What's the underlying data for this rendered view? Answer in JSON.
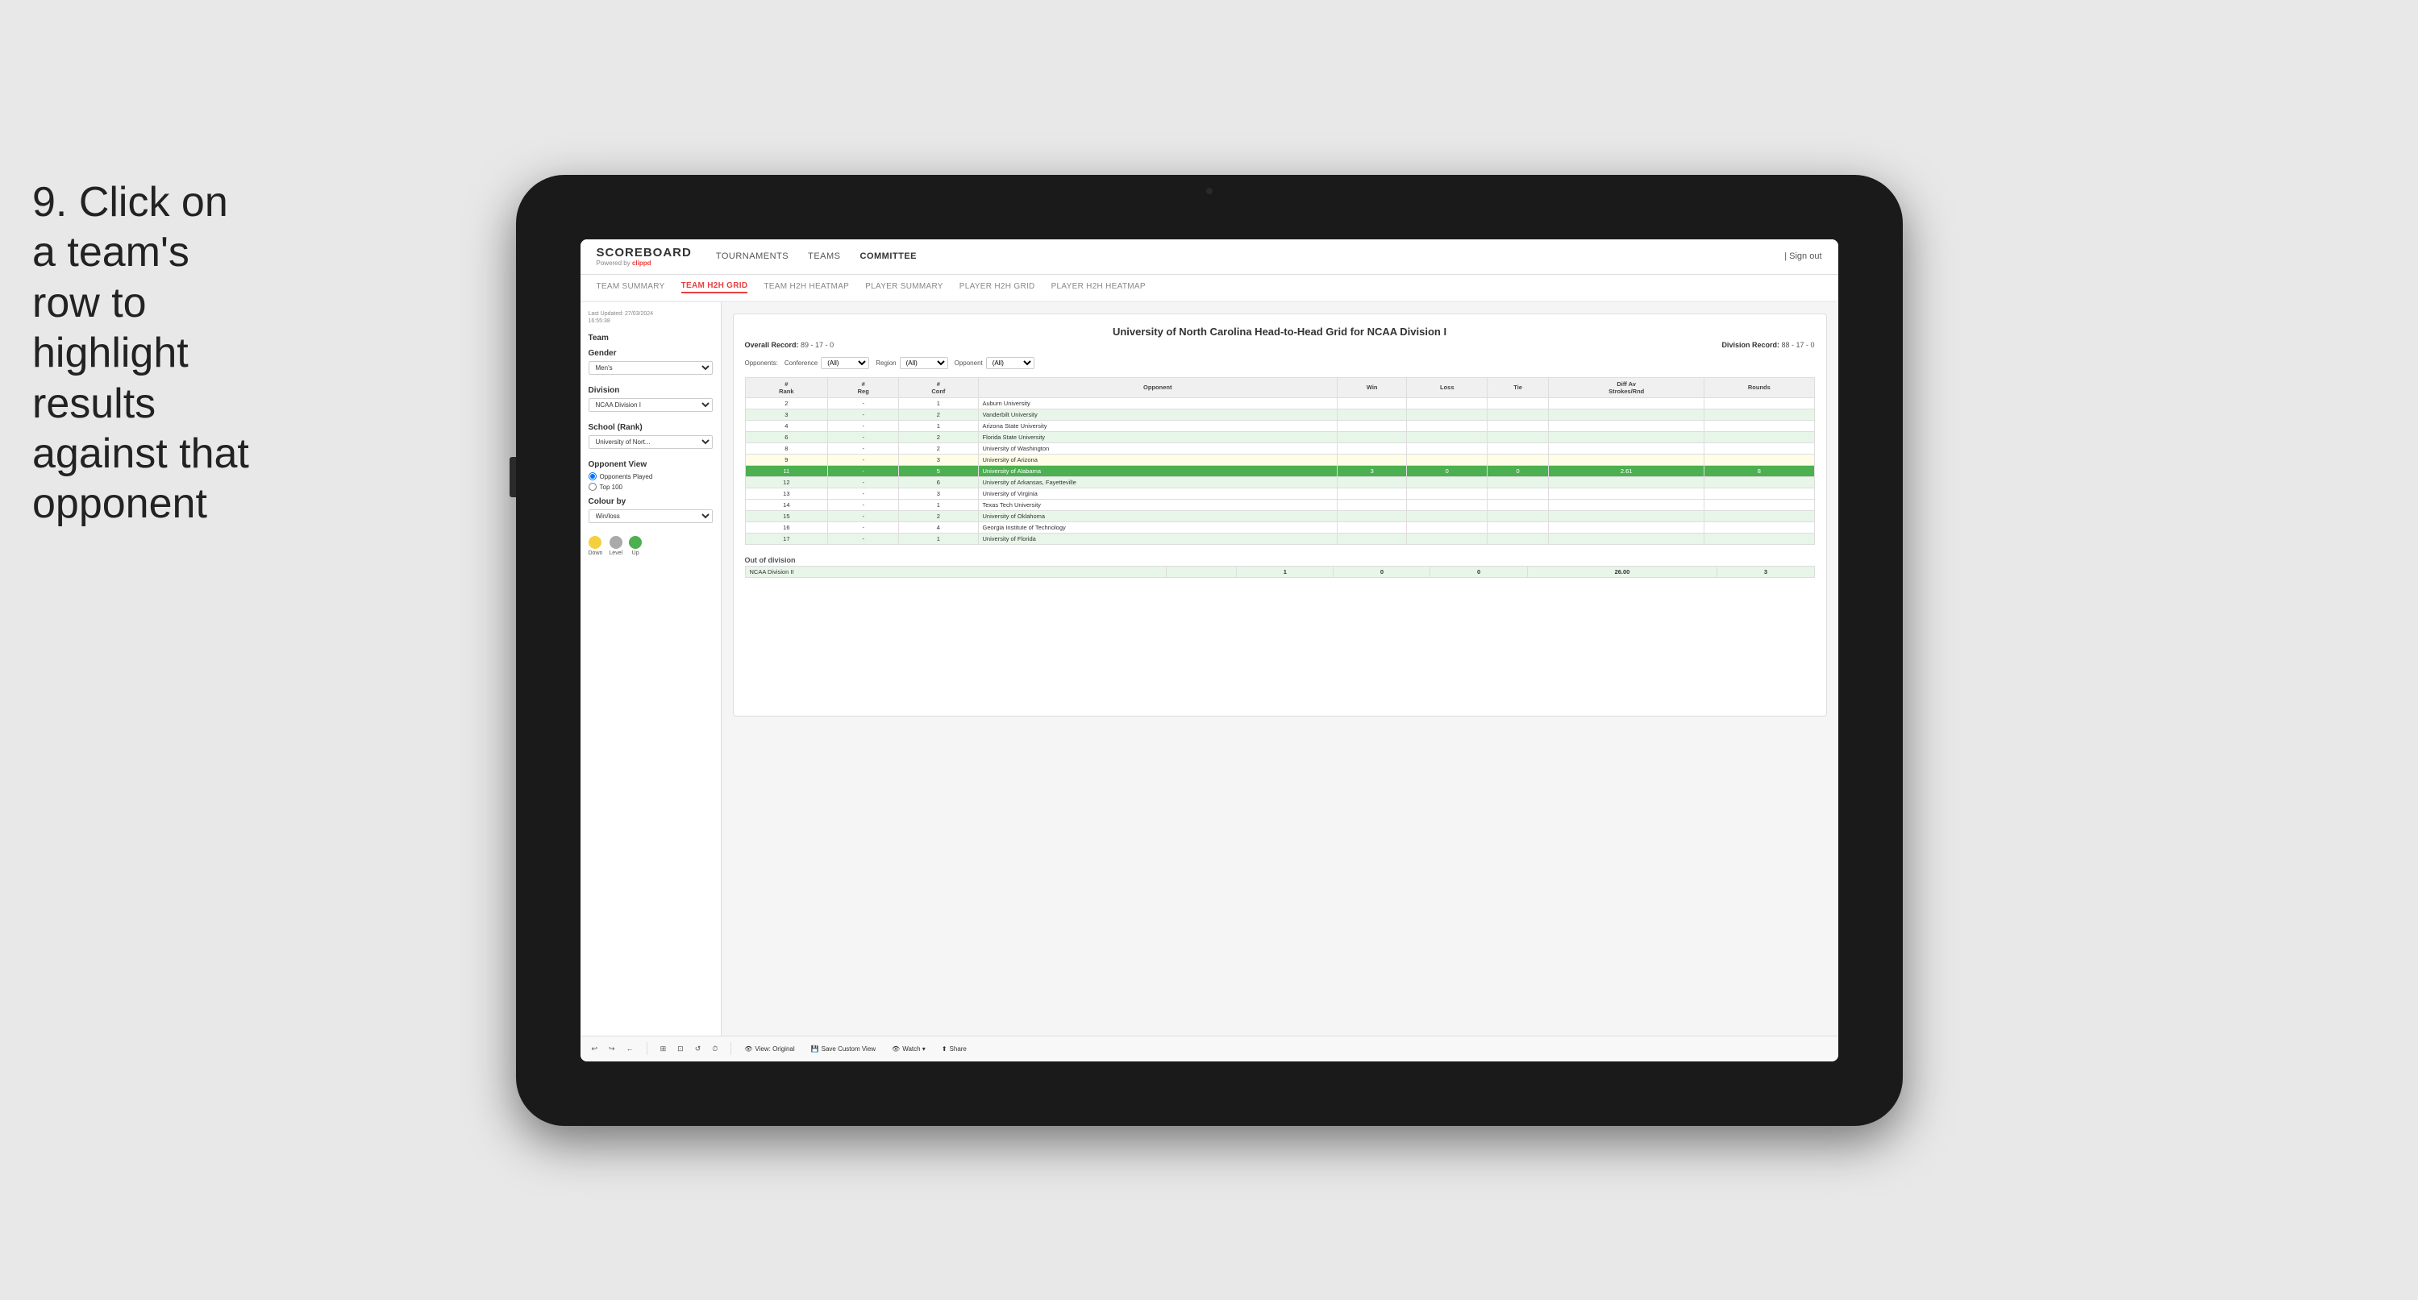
{
  "instruction": {
    "step_number": "9.",
    "text": "Click on a team's row to highlight results against that opponent"
  },
  "app": {
    "logo": {
      "scoreboard": "SCOREBOARD",
      "powered_by": "Powered by",
      "clippd": "clippd"
    },
    "nav": {
      "items": [
        {
          "label": "TOURNAMENTS",
          "active": false
        },
        {
          "label": "TEAMS",
          "active": false
        },
        {
          "label": "COMMITTEE",
          "active": true
        }
      ],
      "sign_out": "| Sign out"
    },
    "sub_nav": {
      "items": [
        {
          "label": "TEAM SUMMARY",
          "active": false
        },
        {
          "label": "TEAM H2H GRID",
          "active": true
        },
        {
          "label": "TEAM H2H HEATMAP",
          "active": false
        },
        {
          "label": "PLAYER SUMMARY",
          "active": false
        },
        {
          "label": "PLAYER H2H GRID",
          "active": false
        },
        {
          "label": "PLAYER H2H HEATMAP",
          "active": false
        }
      ]
    }
  },
  "left_panel": {
    "last_updated_label": "Last Updated: 27/03/2024",
    "last_updated_time": "16:55:38",
    "team_label": "Team",
    "gender_label": "Gender",
    "gender_value": "Men's",
    "division_label": "Division",
    "division_value": "NCAA Division I",
    "school_rank_label": "School (Rank)",
    "school_rank_value": "University of Nort...",
    "opponent_view_label": "Opponent View",
    "opponents_played_label": "Opponents Played",
    "top_100_label": "Top 100",
    "colour_by_label": "Colour by",
    "colour_by_value": "Win/loss",
    "legend": {
      "down_label": "Down",
      "level_label": "Level",
      "up_label": "Up"
    }
  },
  "report": {
    "title": "University of North Carolina Head-to-Head Grid for NCAA Division I",
    "overall_record_label": "Overall Record:",
    "overall_record_value": "89 - 17 - 0",
    "division_record_label": "Division Record:",
    "division_record_value": "88 - 17 - 0",
    "filters": {
      "opponents_label": "Opponents:",
      "conference_label": "Conference",
      "conference_value": "(All)",
      "region_label": "Region",
      "region_value": "(All)",
      "opponent_label": "Opponent",
      "opponent_value": "(All)"
    },
    "table_headers": {
      "rank": "#\nRank",
      "reg": "#\nReg",
      "conf": "#\nConf",
      "opponent": "Opponent",
      "win": "Win",
      "loss": "Loss",
      "tie": "Tie",
      "diff_av": "Diff Av\nStrokes/Rnd",
      "rounds": "Rounds"
    },
    "rows": [
      {
        "rank": "2",
        "reg": "-",
        "conf": "1",
        "opponent": "Auburn University",
        "win": "",
        "loss": "",
        "tie": "",
        "diff": "",
        "rounds": "",
        "style": "normal"
      },
      {
        "rank": "3",
        "reg": "-",
        "conf": "2",
        "opponent": "Vanderbilt University",
        "win": "",
        "loss": "",
        "tie": "",
        "diff": "",
        "rounds": "",
        "style": "light-green"
      },
      {
        "rank": "4",
        "reg": "-",
        "conf": "1",
        "opponent": "Arizona State University",
        "win": "",
        "loss": "",
        "tie": "",
        "diff": "",
        "rounds": "",
        "style": "normal"
      },
      {
        "rank": "6",
        "reg": "-",
        "conf": "2",
        "opponent": "Florida State University",
        "win": "",
        "loss": "",
        "tie": "",
        "diff": "",
        "rounds": "",
        "style": "light-green"
      },
      {
        "rank": "8",
        "reg": "-",
        "conf": "2",
        "opponent": "University of Washington",
        "win": "",
        "loss": "",
        "tie": "",
        "diff": "",
        "rounds": "",
        "style": "normal"
      },
      {
        "rank": "9",
        "reg": "-",
        "conf": "3",
        "opponent": "University of Arizona",
        "win": "",
        "loss": "",
        "tie": "",
        "diff": "",
        "rounds": "",
        "style": "light-yellow"
      },
      {
        "rank": "11",
        "reg": "-",
        "conf": "5",
        "opponent": "University of Alabama",
        "win": "3",
        "loss": "0",
        "tie": "0",
        "diff": "2.61",
        "rounds": "8",
        "style": "highlighted"
      },
      {
        "rank": "12",
        "reg": "-",
        "conf": "6",
        "opponent": "University of Arkansas, Fayetteville",
        "win": "",
        "loss": "",
        "tie": "",
        "diff": "",
        "rounds": "",
        "style": "light-green"
      },
      {
        "rank": "13",
        "reg": "-",
        "conf": "3",
        "opponent": "University of Virginia",
        "win": "",
        "loss": "",
        "tie": "",
        "diff": "",
        "rounds": "",
        "style": "normal"
      },
      {
        "rank": "14",
        "reg": "-",
        "conf": "1",
        "opponent": "Texas Tech University",
        "win": "",
        "loss": "",
        "tie": "",
        "diff": "",
        "rounds": "",
        "style": "normal"
      },
      {
        "rank": "15",
        "reg": "-",
        "conf": "2",
        "opponent": "University of Oklahoma",
        "win": "",
        "loss": "",
        "tie": "",
        "diff": "",
        "rounds": "",
        "style": "light-green"
      },
      {
        "rank": "16",
        "reg": "-",
        "conf": "4",
        "opponent": "Georgia Institute of Technology",
        "win": "",
        "loss": "",
        "tie": "",
        "diff": "",
        "rounds": "",
        "style": "normal"
      },
      {
        "rank": "17",
        "reg": "-",
        "conf": "1",
        "opponent": "University of Florida",
        "win": "",
        "loss": "",
        "tie": "",
        "diff": "",
        "rounds": "",
        "style": "light-green"
      }
    ],
    "out_of_division_label": "Out of division",
    "out_of_division_row": {
      "division": "NCAA Division II",
      "win": "1",
      "loss": "0",
      "tie": "0",
      "diff": "26.00",
      "rounds": "3"
    }
  },
  "toolbar": {
    "undo_label": "↩",
    "redo_label": "↪",
    "back_label": "←",
    "view_label": "View: Original",
    "save_custom_label": "Save Custom View",
    "watch_label": "Watch ▾",
    "share_label": "Share"
  },
  "colors": {
    "active_nav": "#e84040",
    "highlight_row": "#4caf50",
    "light_green": "#e8f5e9",
    "light_yellow": "#fffde7",
    "legend_down": "#f4d03f",
    "legend_level": "#aaa",
    "legend_up": "#4caf50"
  }
}
